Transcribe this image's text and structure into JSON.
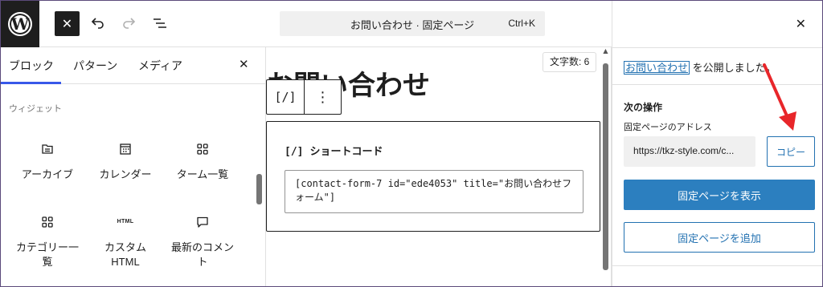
{
  "topbar": {
    "command_title": "お問い合わせ · 固定ページ",
    "command_shortcut": "Ctrl+K",
    "close_symbol": "✕"
  },
  "inserter": {
    "tabs": [
      "ブロック",
      "パターン",
      "メディア"
    ],
    "active_tab": "ブロック",
    "close_symbol": "✕",
    "category": "ウィジェット",
    "blocks": [
      {
        "label": "アーカイブ",
        "icon": "archive-icon"
      },
      {
        "label": "カレンダー",
        "icon": "calendar-icon"
      },
      {
        "label": "ターム一覧",
        "icon": "grid-icon"
      },
      {
        "label": "カテゴリー一覧",
        "label_lines": [
          "カテゴリー一",
          "覧"
        ],
        "icon": "grid-icon"
      },
      {
        "label": "カスタム HTML",
        "label_lines": [
          "カスタム",
          "HTML"
        ],
        "icon": "html-icon",
        "icon_text": "HTML"
      },
      {
        "label": "最新のコメント",
        "label_lines": [
          "最新のコメン",
          "ト"
        ],
        "icon": "comment-icon"
      }
    ]
  },
  "canvas": {
    "page_title": "お問い合わせ",
    "char_count": "文字数: 6",
    "toolbar_shortcode_glyph": "[/]",
    "toolbar_more": "⋮",
    "shortcode_block": {
      "glyph": "[/]",
      "title": "ショートコード",
      "value": "[contact-form-7 id=\"ede4053\" title=\"お問い合わせフォーム\"]"
    }
  },
  "panel": {
    "close_symbol": "✕",
    "published_link": "お問い合わせ",
    "published_suffix": " を公開しました。",
    "next_heading": "次の操作",
    "address_label": "固定ページのアドレス",
    "url": "https://tkz-style.com/c...",
    "copy_label": "コピー",
    "view_label": "固定ページを表示",
    "add_label": "固定ページを追加"
  },
  "colors": {
    "accent_blue": "#2271b1",
    "primary_button": "#2c7fbf",
    "tab_underline": "#3858e9",
    "annotation_arrow": "#e8262a",
    "dark": "#1e1e1e"
  }
}
